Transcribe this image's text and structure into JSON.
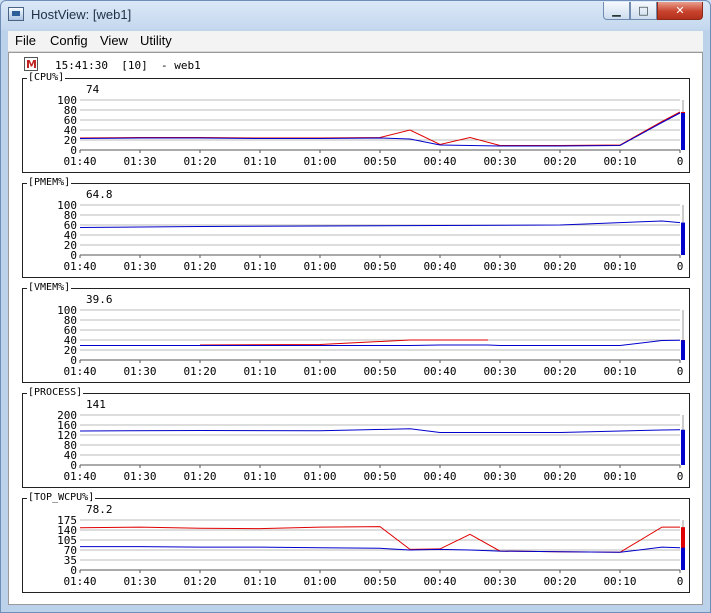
{
  "window": {
    "title": "HostView: [web1]",
    "min_glyph": "▁",
    "max_glyph": "□",
    "close_glyph": "✕"
  },
  "menu": [
    "File",
    "Config",
    "View",
    "Utility"
  ],
  "status": {
    "time": "15:41:30",
    "interval": "[10]",
    "host": "- web1"
  },
  "x_ticks": [
    "01:40",
    "01:30",
    "01:20",
    "01:10",
    "01:00",
    "00:50",
    "00:40",
    "00:30",
    "00:20",
    "00:10",
    "0"
  ],
  "colors": {
    "primary": "#0000cc",
    "secondary": "#e00000",
    "grid": "#bbbbbb"
  },
  "panels": [
    {
      "title": "[CPU%]",
      "value": "74",
      "y_ticks": [
        "100",
        "80",
        "60",
        "40",
        "20",
        "0"
      ]
    },
    {
      "title": "[PMEM%]",
      "value": "64.8",
      "y_ticks": [
        "100",
        "80",
        "60",
        "40",
        "20",
        "0"
      ]
    },
    {
      "title": "[VMEM%]",
      "value": "39.6",
      "y_ticks": [
        "100",
        "80",
        "60",
        "40",
        "20",
        "0"
      ]
    },
    {
      "title": "[PROCESS]",
      "value": "141",
      "y_ticks": [
        "200",
        "160",
        "120",
        "80",
        "40",
        "0"
      ]
    },
    {
      "title": "[TOP_WCPU%]",
      "value": "78.2",
      "y_ticks": [
        "175",
        "140",
        "105",
        "70",
        "35",
        "0"
      ]
    }
  ],
  "chart_data": [
    {
      "type": "line",
      "title": "[CPU%]",
      "ylim": [
        0,
        100
      ],
      "current": 74,
      "x": [
        "01:40",
        "01:30",
        "01:20",
        "01:10",
        "01:00",
        "00:50",
        "00:45",
        "00:40",
        "00:35",
        "00:30",
        "00:20",
        "00:10",
        "00:03",
        "0"
      ],
      "series": [
        {
          "values": [
            23,
            24,
            24,
            23,
            23,
            24,
            22,
            10,
            9,
            8,
            8,
            9,
            55,
            74
          ]
        },
        {
          "values": [
            24,
            25,
            25,
            24,
            24,
            25,
            40,
            11,
            25,
            9,
            9,
            10,
            57,
            76
          ]
        }
      ]
    },
    {
      "type": "line",
      "title": "[PMEM%]",
      "ylim": [
        0,
        100
      ],
      "current": 64.8,
      "x": [
        "01:40",
        "01:20",
        "01:00",
        "00:40",
        "00:20",
        "00:03",
        "0"
      ],
      "series": [
        {
          "values": [
            55,
            57,
            58,
            59,
            60,
            68,
            64.8
          ]
        }
      ]
    },
    {
      "type": "line",
      "title": "[VMEM%]",
      "ylim": [
        0,
        100
      ],
      "current": 39.6,
      "x": [
        "01:40",
        "01:20",
        "01:00",
        "00:45",
        "00:40",
        "00:32",
        "00:30",
        "00:10",
        "00:03",
        "0"
      ],
      "series": [
        {
          "values": [
            29,
            29,
            29,
            29,
            30,
            30,
            29,
            29,
            39,
            39.6
          ]
        },
        {
          "values": [
            null,
            30,
            31,
            40,
            40,
            40,
            null,
            null,
            null,
            null
          ]
        }
      ]
    },
    {
      "type": "line",
      "title": "[PROCESS]",
      "ylim": [
        0,
        200
      ],
      "current": 141,
      "x": [
        "01:40",
        "01:20",
        "01:00",
        "00:45",
        "00:40",
        "00:20",
        "00:03",
        "0"
      ],
      "series": [
        {
          "values": [
            136,
            138,
            137,
            145,
            130,
            130,
            140,
            141
          ]
        }
      ]
    },
    {
      "type": "line",
      "title": "[TOP_WCPU%]",
      "ylim": [
        0,
        175
      ],
      "current": 78.2,
      "x": [
        "01:40",
        "01:30",
        "01:20",
        "01:10",
        "01:00",
        "00:50",
        "00:45",
        "00:40",
        "00:35",
        "00:30",
        "00:20",
        "00:10",
        "00:03",
        "0"
      ],
      "series": [
        {
          "values": [
            82,
            82,
            80,
            80,
            78,
            76,
            70,
            72,
            70,
            66,
            64,
            62,
            80,
            78.2
          ]
        },
        {
          "values": [
            148,
            150,
            146,
            145,
            150,
            152,
            72,
            74,
            125,
            66,
            64,
            62,
            150,
            150
          ]
        }
      ]
    }
  ]
}
